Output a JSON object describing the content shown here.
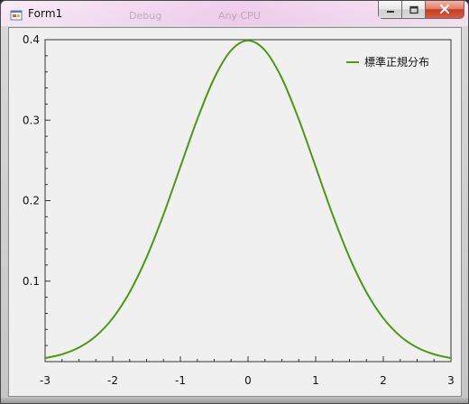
{
  "window": {
    "title": "Form1",
    "icon": "windows-form-icon",
    "buttons": {
      "minimize": "minimize-icon",
      "maximize": "maximize-icon",
      "close": "close-icon"
    },
    "background_menu": {
      "item1": "Debug",
      "item2": "Any CPU"
    }
  },
  "chart_data": {
    "type": "line",
    "title": "",
    "xlabel": "",
    "ylabel": "",
    "xlim": [
      -3,
      3
    ],
    "ylim": [
      0,
      0.4
    ],
    "x_ticks": [
      -3,
      -2,
      -1,
      0,
      1,
      2,
      3
    ],
    "y_ticks": [
      0.1,
      0.2,
      0.3,
      0.4
    ],
    "grid": false,
    "legend": {
      "placement": "top-right"
    },
    "series": [
      {
        "name": "標準正規分布",
        "color": "#4a9a12",
        "x": [
          -3,
          -2.75,
          -2.5,
          -2.25,
          -2,
          -1.75,
          -1.5,
          -1.25,
          -1,
          -0.75,
          -0.5,
          -0.25,
          0,
          0.25,
          0.5,
          0.75,
          1,
          1.25,
          1.5,
          1.75,
          2,
          2.25,
          2.5,
          2.75,
          3
        ],
        "y": [
          0.0044,
          0.0091,
          0.0175,
          0.0317,
          0.054,
          0.0863,
          0.1295,
          0.1826,
          0.242,
          0.3011,
          0.3521,
          0.3867,
          0.3989,
          0.3867,
          0.3521,
          0.3011,
          0.242,
          0.1826,
          0.1295,
          0.0863,
          0.054,
          0.0317,
          0.0175,
          0.0091,
          0.0044
        ]
      }
    ]
  }
}
